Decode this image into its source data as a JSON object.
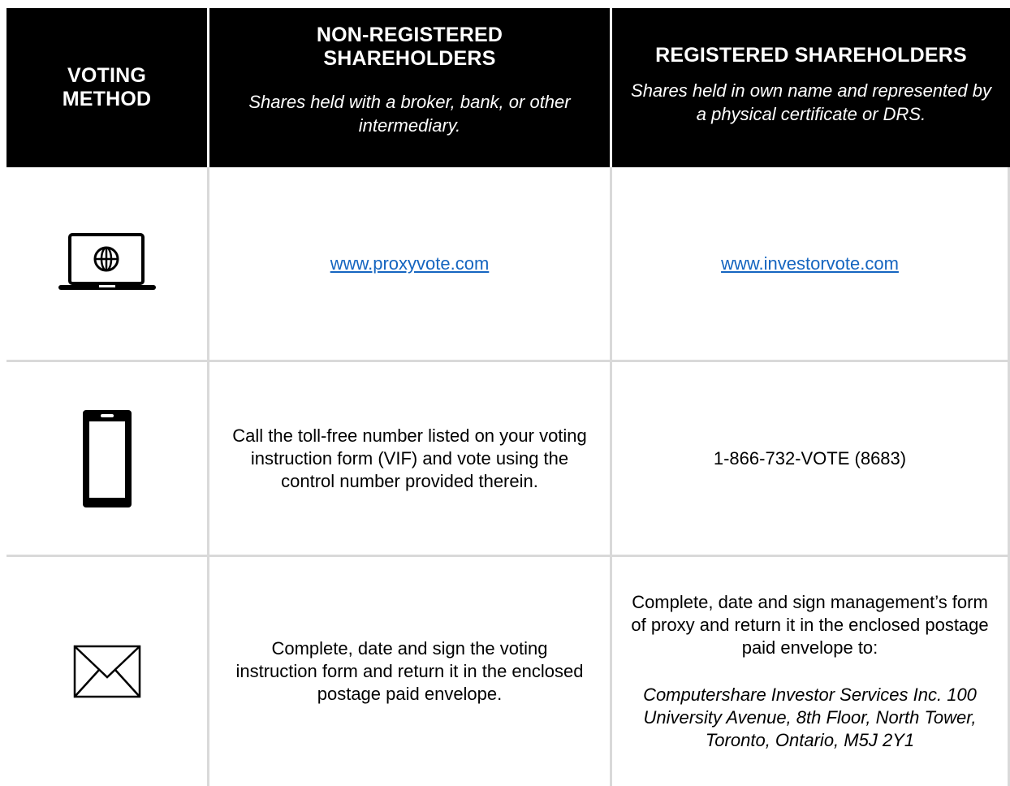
{
  "header": {
    "method": "VOTING METHOD",
    "non_registered": {
      "title": "NON-REGISTERED SHAREHOLDERS",
      "subtitle": "Shares held with a broker, bank, or other intermediary."
    },
    "registered": {
      "title": "REGISTERED SHAREHOLDERS",
      "subtitle": "Shares held in own name and represented by a physical certificate or DRS."
    }
  },
  "rows": [
    {
      "icon": "laptop-globe-icon",
      "non_registered": "www.proxyvote.com",
      "registered": "www.investorvote.com"
    },
    {
      "icon": "mobile-phone-icon",
      "non_registered": "Call the toll-free number listed on your voting instruction form (VIF) and vote using the control number provided therein.",
      "registered": "1-866-732-VOTE (8683)"
    },
    {
      "icon": "envelope-icon",
      "non_registered": "Complete, date and sign the voting instruction form and return it in the enclosed postage paid envelope.",
      "registered": "Complete, date and sign management’s form of proxy and return it in the enclosed postage paid envelope to:",
      "registered_address": "Computershare Investor Services Inc. 100 University Avenue, 8th Floor, North Tower, Toronto, Ontario, M5J 2Y1"
    }
  ],
  "colors": {
    "header_bg": "#000000",
    "header_text": "#ffffff",
    "link": "#1565c0",
    "grid_line": "#d9d9d9"
  }
}
